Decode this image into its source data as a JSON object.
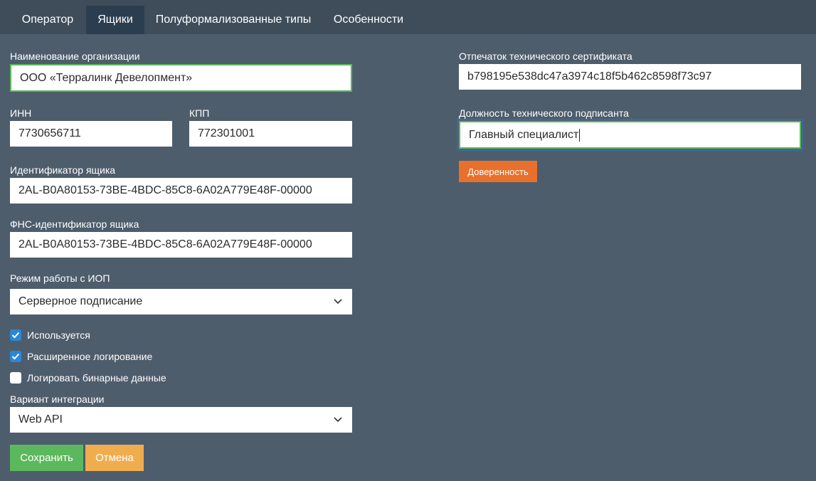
{
  "tabs": [
    "Оператор",
    "Ящики",
    "Полуформализованные типы",
    "Особенности"
  ],
  "active_tab": "Ящики",
  "colors": {
    "background": "#4e5d6c",
    "tab_bar": "#3f4d5b",
    "tab_active": "#2b3e50",
    "checkbox_on": "#2a87d9",
    "focus_border": "#5cb85c",
    "save_button": "#5cb85c",
    "cancel_button": "#f0ad4e",
    "power_of_attorney_button": "#e8702a"
  },
  "form": {
    "org_name_label": "Наименование организации",
    "org_name_value": "ООО «Терралинк Девелопмент»",
    "inn_label": "ИНН",
    "inn_value": "7730656711",
    "kpp_label": "КПП",
    "kpp_value": "772301001",
    "box_id_label": "Идентификатор ящика",
    "box_id_value": "2AL-B0A80153-73BE-4BDC-85C8-6A02A779E48F-00000",
    "fns_box_id_label": "ФНС-идентификатор ящика",
    "fns_box_id_value": "2AL-B0A80153-73BE-4BDC-85C8-6A02A779E48F-00000",
    "iop_mode_label": "Режим работы с ИОП",
    "iop_mode_value": "Серверное подписание",
    "checkboxes": [
      {
        "label": "Используется",
        "checked": true
      },
      {
        "label": "Расширенное логирование",
        "checked": true
      },
      {
        "label": "Логировать бинарные данные",
        "checked": false
      }
    ],
    "integration_label": "Вариант интеграции",
    "integration_value": "Web API",
    "cert_label": "Отпечаток технического сертификата",
    "cert_value": "b798195e538dc47a3974c18f5b462c8598f73c97",
    "signer_position_label": "Должность технического подписанта",
    "signer_position_value": "Главный специалист",
    "power_of_attorney_button": "Доверенность",
    "save_button": "Сохранить",
    "cancel_button": "Отмена"
  }
}
